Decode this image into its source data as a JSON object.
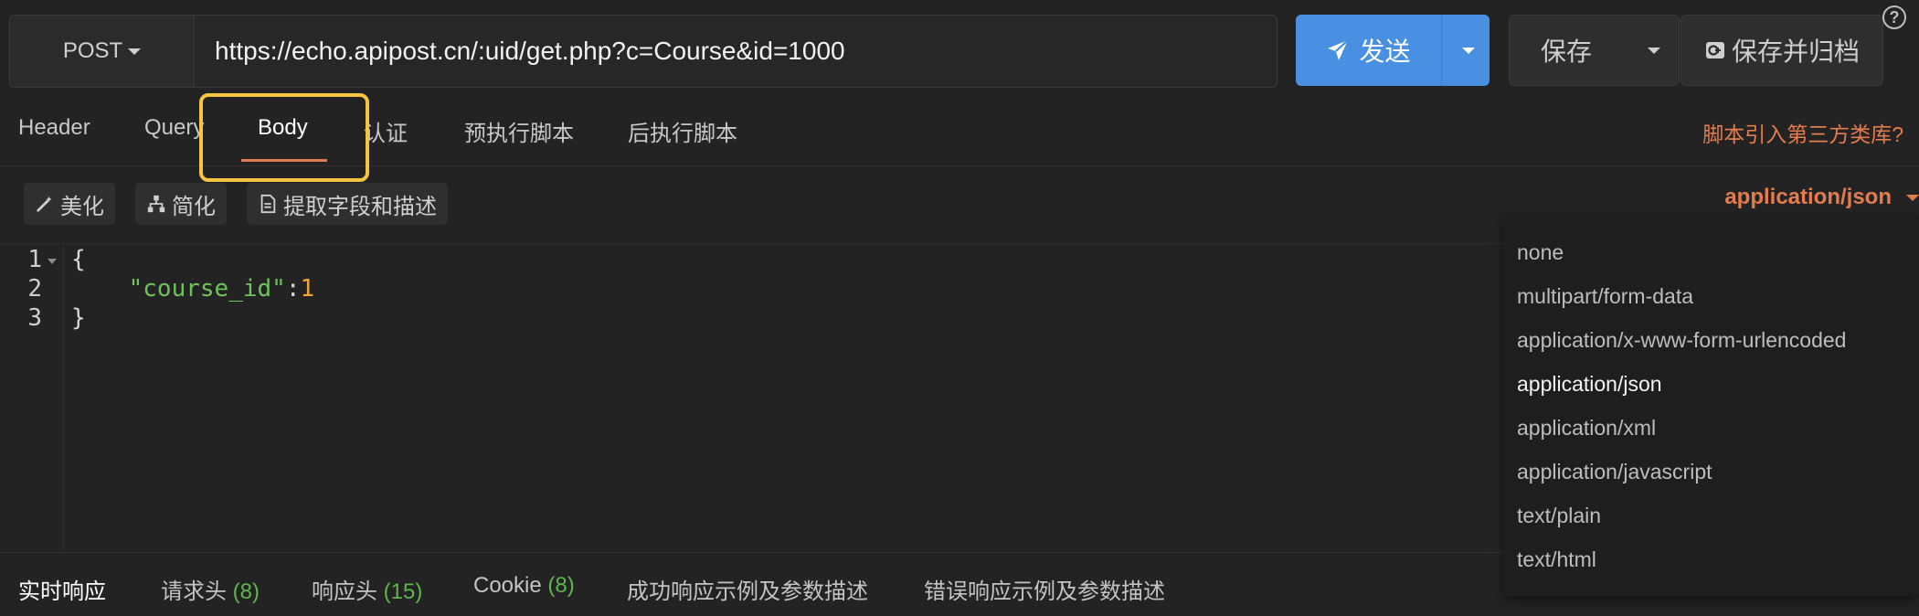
{
  "request": {
    "method": "POST",
    "url": "https://echo.apipost.cn/:uid/get.php?c=Course&id=1000",
    "send_label": "发送",
    "save_label": "保存",
    "save_archive_label": "保存并归档"
  },
  "tabs": [
    {
      "label": "Header",
      "active": false
    },
    {
      "label": "Query",
      "active": false
    },
    {
      "label": "Body",
      "active": true
    },
    {
      "label": "认证",
      "active": false
    },
    {
      "label": "预执行脚本",
      "active": false
    },
    {
      "label": "后执行脚本",
      "active": false
    }
  ],
  "script_link": "脚本引入第三方类库?",
  "toolbar": {
    "beautify": "美化",
    "simplify": "简化",
    "extract": "提取字段和描述"
  },
  "content_type": {
    "selected": "application/json",
    "options": [
      "none",
      "multipart/form-data",
      "application/x-www-form-urlencoded",
      "application/json",
      "application/xml",
      "application/javascript",
      "text/plain",
      "text/html"
    ]
  },
  "editor": {
    "line_numbers": [
      "1",
      "2",
      "3"
    ],
    "lines": {
      "l1": "{",
      "l2_indent": "    ",
      "l2_key": "\"course_id\"",
      "l2_colon": ":",
      "l2_value": "1",
      "l3": "}"
    }
  },
  "bottom_tabs": [
    {
      "label": "实时响应",
      "count": "",
      "active": true
    },
    {
      "label": "请求头 ",
      "count": "(8)",
      "active": false
    },
    {
      "label": "响应头 ",
      "count": "(15)",
      "active": false
    },
    {
      "label": "Cookie ",
      "count": "(8)",
      "active": false
    },
    {
      "label": "成功响应示例及参数描述",
      "count": "",
      "active": false
    },
    {
      "label": "错误响应示例及参数描述",
      "count": "",
      "active": false
    }
  ],
  "colors": {
    "accent_orange": "#e57c4e",
    "send_blue": "#4a90e2",
    "highlight_yellow": "#f5c542",
    "json_key_green": "#6fc35a",
    "json_number_orange": "#f0a536"
  }
}
